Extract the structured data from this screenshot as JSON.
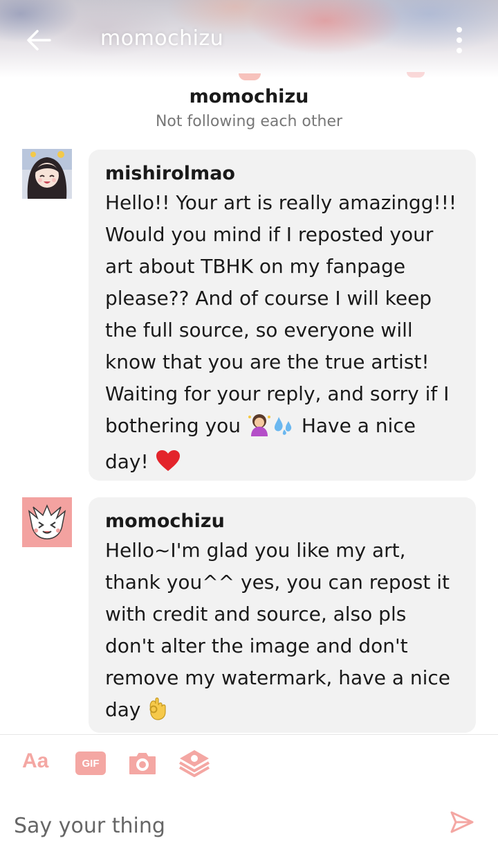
{
  "header": {
    "title": "momochizu",
    "back_icon": "arrow-left-icon",
    "menu_icon": "more-vertical-icon"
  },
  "conversation": {
    "name": "momochizu",
    "status": "Not following each other"
  },
  "messages": [
    {
      "author": "mishirolmao",
      "text_1": "Hello!! Your art is really amazingg!!! Would you mind if I reposted your art about TBHK on my fanpage please?? And of course I will keep the full source, so everyone will know that you are the true artist! Waiting for your reply, and sorry if I bothering you",
      "text_2": " Have a nice day!",
      "emojis": [
        "person-bowing-emoji",
        "sweat-droplets-emoji",
        "red-heart-emoji"
      ]
    },
    {
      "author": "momochizu",
      "text_1": "Hello~I'm glad you like my art, thank you^^ yes, you can repost it with credit and source, also pls don't alter the image and don't remove my watermark, have a nice day",
      "emojis": [
        "ok-hand-emoji"
      ]
    }
  ],
  "composer": {
    "text_tool_label": "Aa",
    "gif_label": "GIF",
    "placeholder": "Say your thing",
    "icons": [
      "camera-icon",
      "sticker-icon",
      "send-icon"
    ]
  },
  "colors": {
    "accent": "#f4a7a3",
    "bubble": "#f2f2f2",
    "status_text": "#777777"
  }
}
